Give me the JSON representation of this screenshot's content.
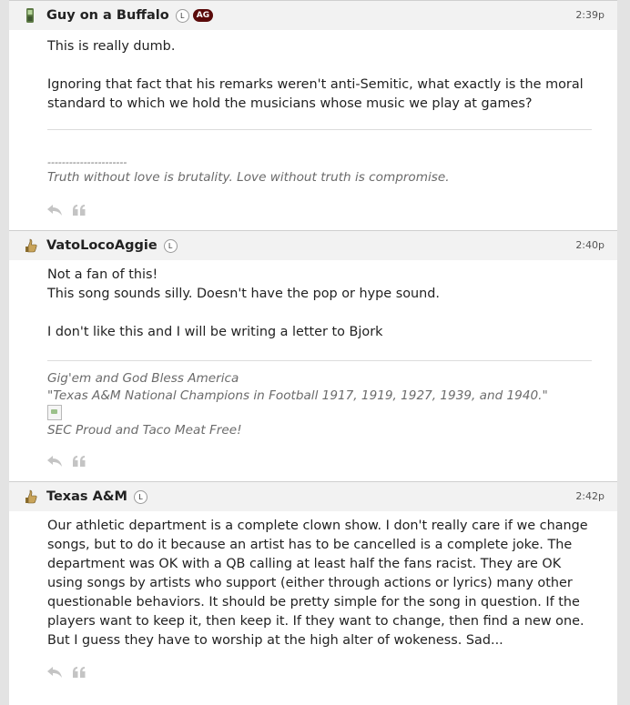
{
  "posts": [
    {
      "username": "Guy on a Buffalo",
      "badge_l": "L",
      "badge_ag": "AG",
      "time": "2:39p",
      "avatar_icon": "green-phone-icon",
      "body": [
        "This is really dumb.",
        "Ignoring that fact that his remarks weren't anti-Semitic, what exactly is the moral standard to which we hold the musicians whose music we play at games?"
      ],
      "signature": {
        "divider": "----------------------",
        "quote": "Truth without love is brutality. Love without truth is compromise."
      }
    },
    {
      "username": "VatoLocoAggie",
      "badge_l": "L",
      "time": "2:40p",
      "avatar_icon": "gig-em-thumb-icon",
      "body": [
        "Not a fan of this!",
        "This song sounds silly. Doesn't have the pop or hype sound.",
        "I don't like this and I will be writing a letter to Bjork"
      ],
      "signature": {
        "line1": "Gig'em and God Bless America",
        "line2": "\"Texas A&M National Champions in Football 1917, 1919, 1927, 1939, and 1940.\"",
        "line3": "SEC Proud and Taco Meat Free!"
      }
    },
    {
      "username": "Texas A&M",
      "badge_l": "L",
      "time": "2:42p",
      "avatar_icon": "gig-em-thumb-icon",
      "body": [
        "Our athletic department is a complete clown show. I don't really care if we change songs, but to do it because an artist has to be cancelled is a complete joke. The department was OK with a QB calling at least half the fans racist. They are OK using songs by artists who support (either through actions or lyrics) many other questionable behaviors. It should be pretty simple for the song in question. If the players want to keep it, then keep it. If they want to change, then find a new one. But I guess they have to worship at the high alter of wokeness. Sad..."
      ]
    }
  ]
}
